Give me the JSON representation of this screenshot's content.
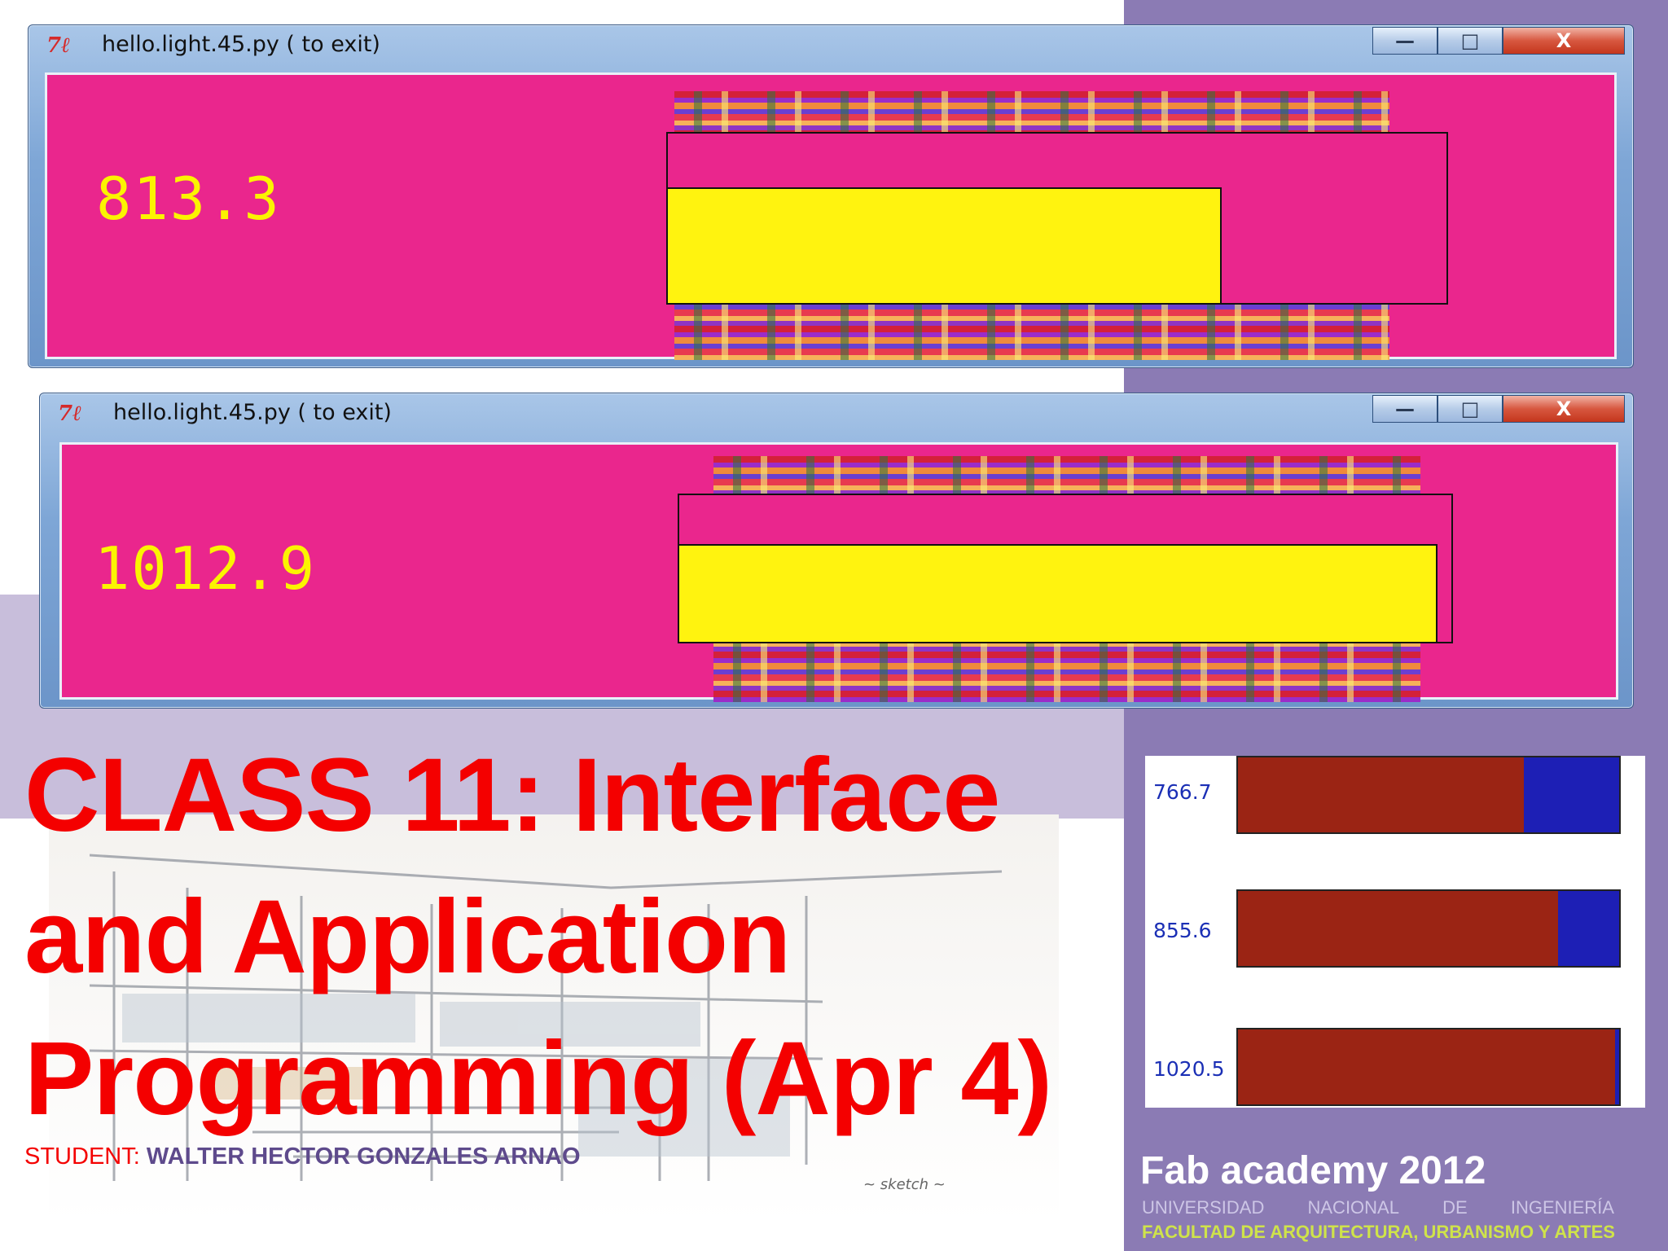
{
  "windows": [
    {
      "title": "hello.light.45.py ( to exit)",
      "icon": "tk-feather-icon",
      "reading": "813.3",
      "level_fraction": 0.71
    },
    {
      "title": "hello.light.45.py ( to exit)",
      "icon": "tk-feather-icon",
      "reading": "1012.9",
      "level_fraction": 0.98
    }
  ],
  "controls": {
    "minimize": "—",
    "maximize": "□",
    "close": "X"
  },
  "mini_app": {
    "bars": [
      {
        "label": "766.7",
        "fill_fraction": 0.75
      },
      {
        "label": "855.6",
        "fill_fraction": 0.84
      },
      {
        "label": "1020.5",
        "fill_fraction": 0.99
      }
    ]
  },
  "slide": {
    "headline_lines": [
      "CLASS 11: Interface",
      "and Application",
      "Programming (Apr 4)"
    ],
    "student_key": "STUDENT:",
    "student_name": "WALTER HECTOR GONZALES ARNAO",
    "fab_academy": "Fab academy 2012",
    "university_words": [
      "UNIVERSIDAD",
      "NACIONAL",
      "DE",
      "INGENIERÍA"
    ],
    "faculty": "FACULTAD DE ARQUITECTURA, URBANISMO Y ARTES"
  },
  "colors": {
    "window_client": "#ea268d",
    "level_bar": "#fff30f",
    "headline": "#f40000",
    "mini_fill": "#9b2414",
    "mini_track": "#1d1fb5",
    "panel_purple": "#8b7bb4"
  }
}
